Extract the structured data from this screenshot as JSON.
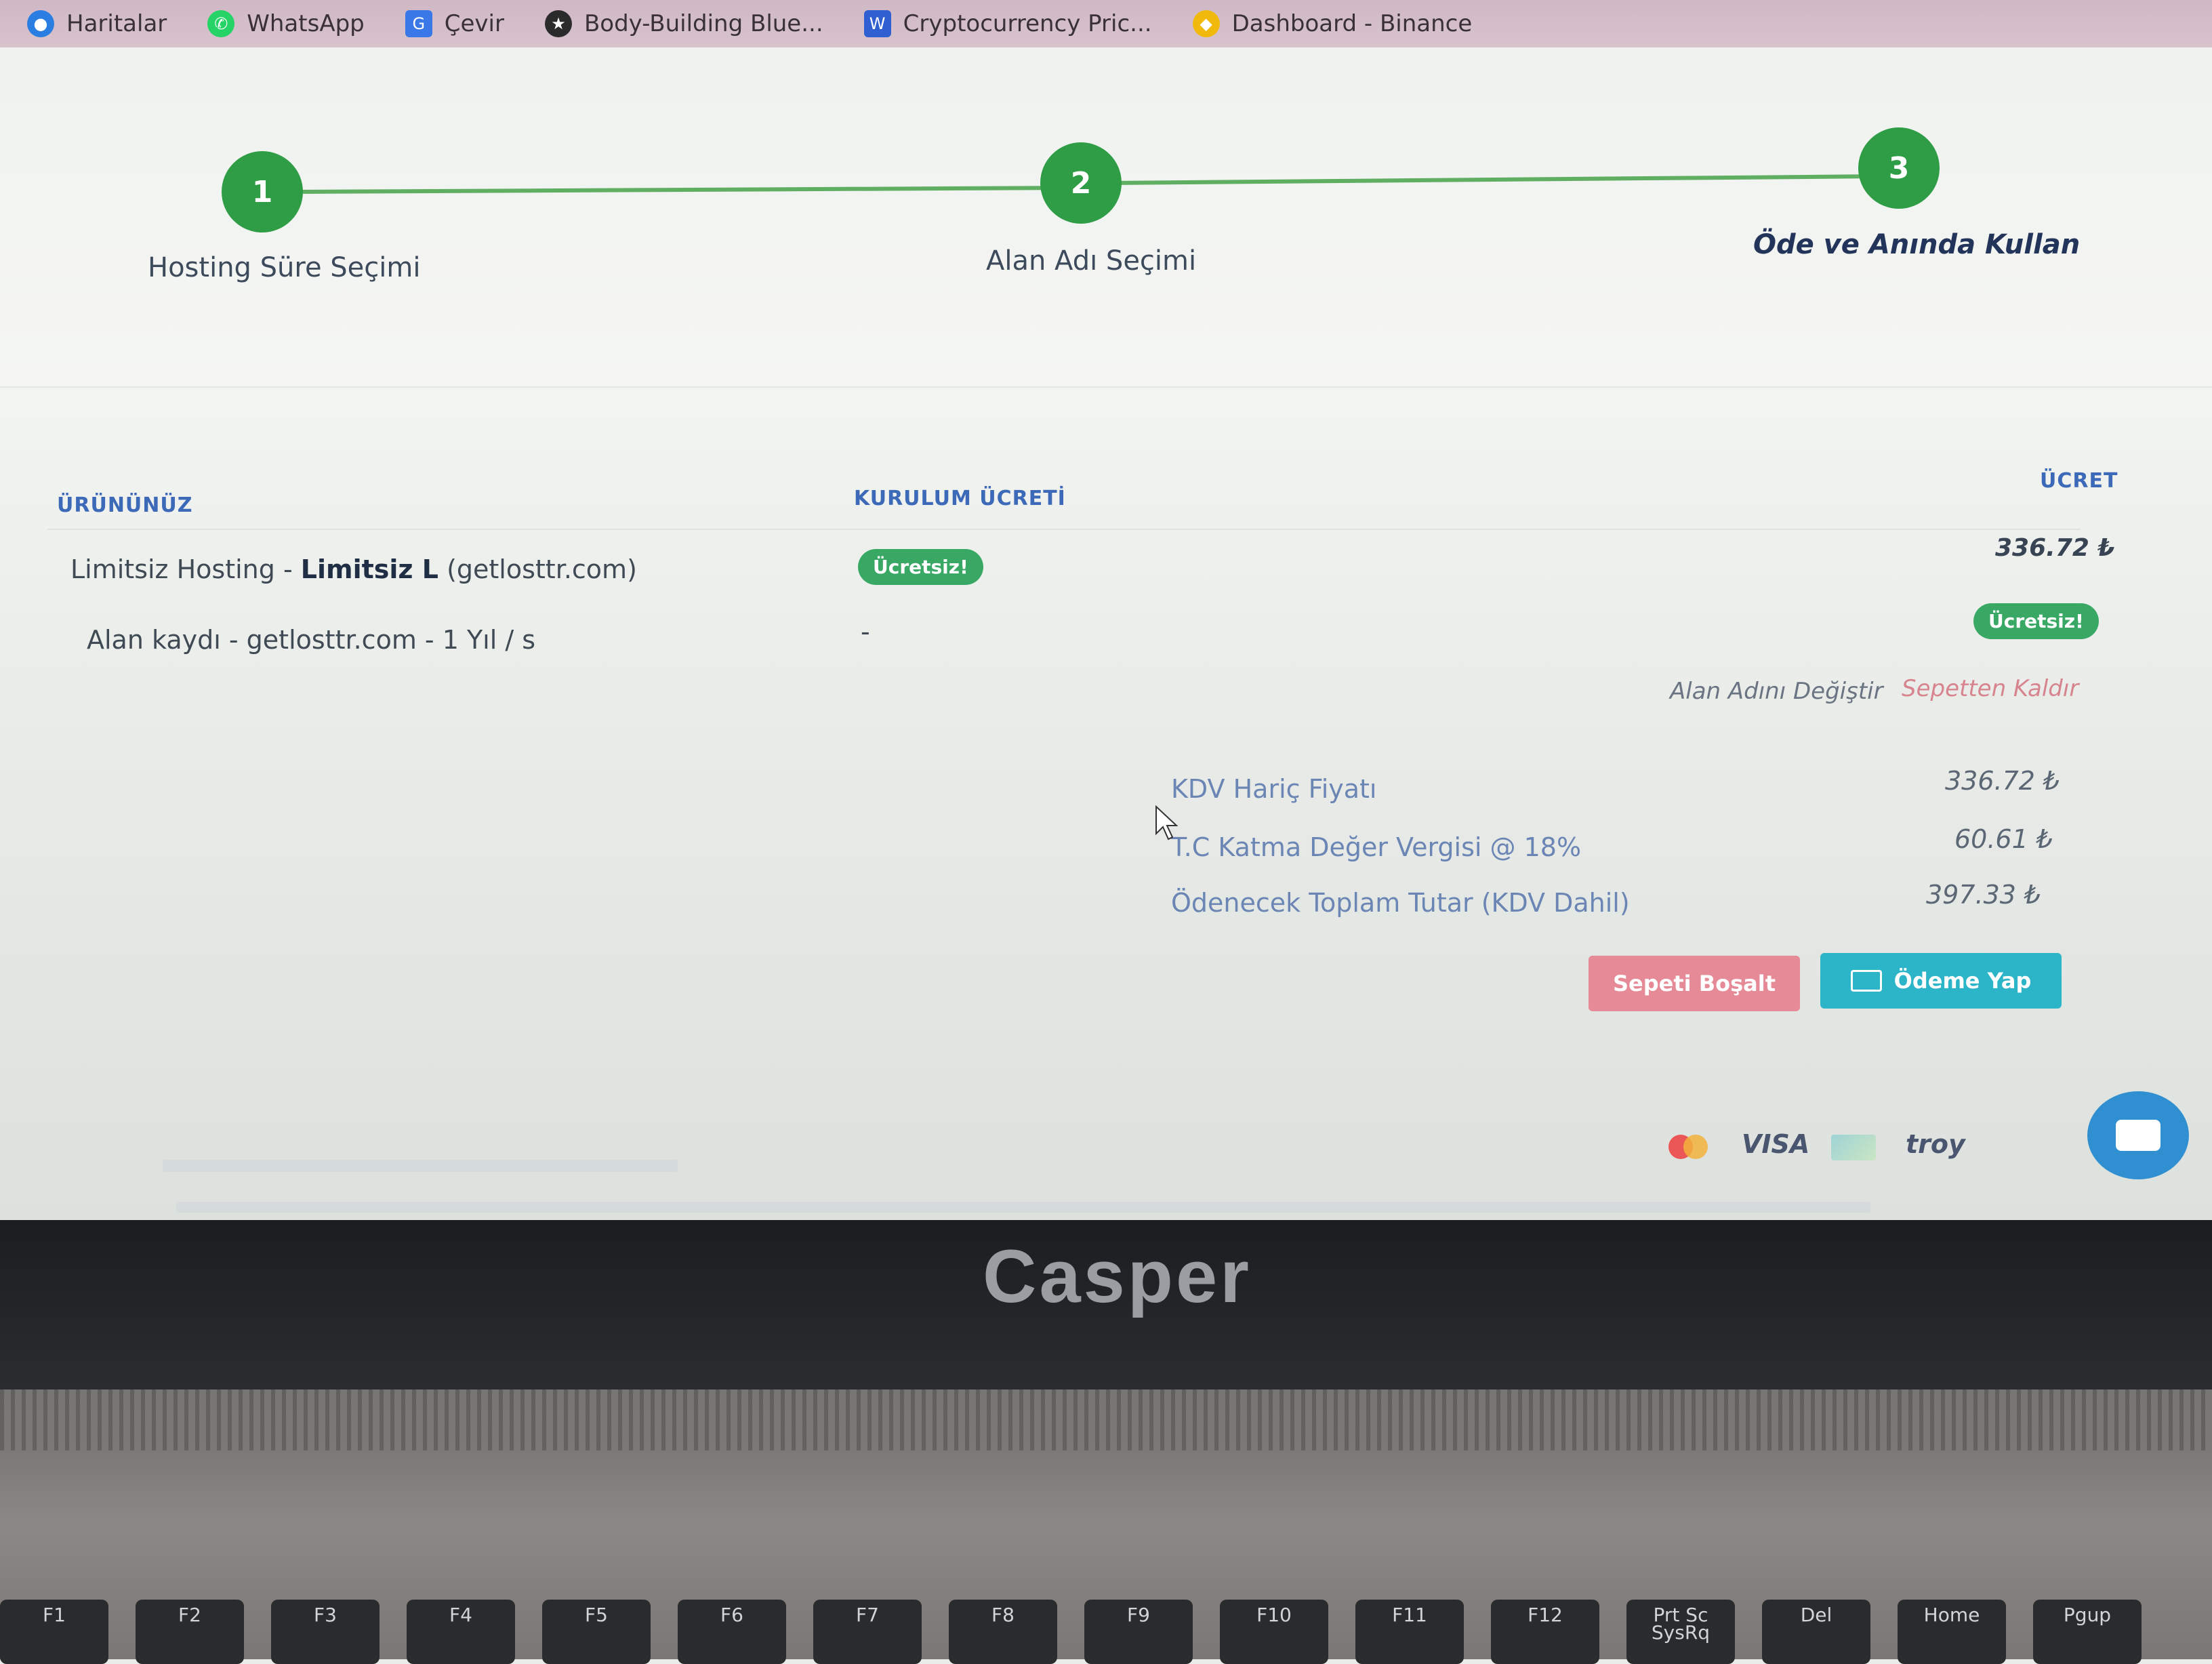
{
  "bookmarks": [
    {
      "label": "Haritalar",
      "icon": "maps-icon",
      "color": "#2a7de1"
    },
    {
      "label": "WhatsApp",
      "icon": "whatsapp-icon",
      "color": "#25d366"
    },
    {
      "label": "Çevir",
      "icon": "translate-icon",
      "color": "#3a78e7"
    },
    {
      "label": "Body-Building Blue...",
      "icon": "bodybuilding-icon",
      "color": "#2b2b2b"
    },
    {
      "label": "Cryptocurrency Pric...",
      "icon": "crypto-icon",
      "color": "#2f5fd0"
    },
    {
      "label": "Dashboard - Binance",
      "icon": "binance-icon",
      "color": "#f0b90b"
    }
  ],
  "stepper": {
    "steps": [
      {
        "number": "1",
        "label": "Hosting Süre Seçimi"
      },
      {
        "number": "2",
        "label": "Alan Adı Seçimi"
      },
      {
        "number": "3",
        "label": "Öde ve Anında Kullan"
      }
    ]
  },
  "cart": {
    "headers": {
      "product": "ÜRÜNÜNÜZ",
      "setup_fee": "KURULUM ÜCRETİ",
      "price": "ÜCRET"
    },
    "item1": {
      "prefix": "Limitsiz Hosting - ",
      "bold": "Limitsiz L",
      "suffix": " (getlosttr.com)",
      "setup_badge": "Ücretsiz!",
      "price": "336.72 ₺"
    },
    "item2": {
      "label": "Alan kaydı - getlosttr.com - 1 Yıl / s",
      "setup": "-",
      "price_badge": "Ücretsiz!",
      "change_link": "Alan Adını Değiştir",
      "remove_link": "Sepetten Kaldır"
    },
    "summary": [
      {
        "label": "KDV Hariç Fiyatı",
        "value": "336.72 ₺"
      },
      {
        "label": "T.C Katma Değer Vergisi @ 18%",
        "value": "60.61 ₺"
      },
      {
        "label": "Ödenecek Toplam Tutar (KDV Dahil)",
        "value": "397.33 ₺"
      }
    ],
    "buttons": {
      "empty": "Sepeti Boşalt",
      "pay": "Ödeme Yap"
    }
  },
  "payment_methods": [
    "VISA",
    "troy"
  ],
  "laptop": {
    "brand": "Casper",
    "keys": [
      "F1",
      "F2",
      "F3",
      "F4",
      "F5",
      "F6",
      "F7",
      "F8",
      "F9",
      "F10",
      "F11",
      "F12",
      "Prt Sc SysRq",
      "Del",
      "Home",
      "Pgup"
    ]
  },
  "colors": {
    "step_green": "#2f9d45",
    "header_blue": "#3c69b8",
    "badge_green": "#3aa865",
    "btn_red": "#e58a96",
    "btn_teal": "#2cb5c9"
  }
}
